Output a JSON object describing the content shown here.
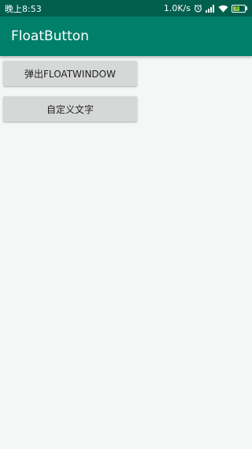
{
  "status_bar": {
    "time": "晚上8:53",
    "network_speed": "1.0K/s",
    "battery_level": "57",
    "icons": [
      "alarm-icon",
      "signal-icon",
      "wifi-icon",
      "battery-icon"
    ]
  },
  "app_bar": {
    "title": "FloatButton"
  },
  "buttons": [
    {
      "label": "弹出FLOATWINDOW"
    },
    {
      "label": "自定义文字"
    }
  ],
  "colors": {
    "status_bar": "#005f4d",
    "app_bar": "#00806a",
    "background": "#f3f7f5",
    "button": "#d6d8d7",
    "battery": "#8bd14a"
  }
}
